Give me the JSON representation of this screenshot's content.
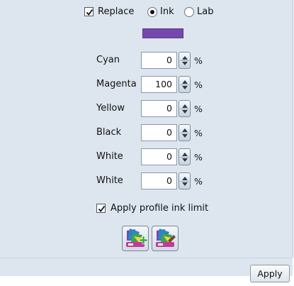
{
  "options": {
    "replace_label": "Replace",
    "replace_checked": true,
    "mode_options": [
      "Ink",
      "Lab"
    ],
    "mode_selected": "Ink"
  },
  "swatch_color": "#7647ad",
  "inks": [
    {
      "label": "Cyan",
      "value": "0",
      "unit": "%"
    },
    {
      "label": "Magenta",
      "value": "100",
      "unit": "%"
    },
    {
      "label": "Yellow",
      "value": "0",
      "unit": "%"
    },
    {
      "label": "Black",
      "value": "0",
      "unit": "%"
    },
    {
      "label": "White",
      "value": "0",
      "unit": "%"
    },
    {
      "label": "White",
      "value": "0",
      "unit": "%"
    }
  ],
  "profile_limit": {
    "label": "Apply profile ink limit",
    "checked": true
  },
  "icon_buttons": [
    "add-profile-icon",
    "edit-profile-icon"
  ],
  "apply_label": "Apply"
}
